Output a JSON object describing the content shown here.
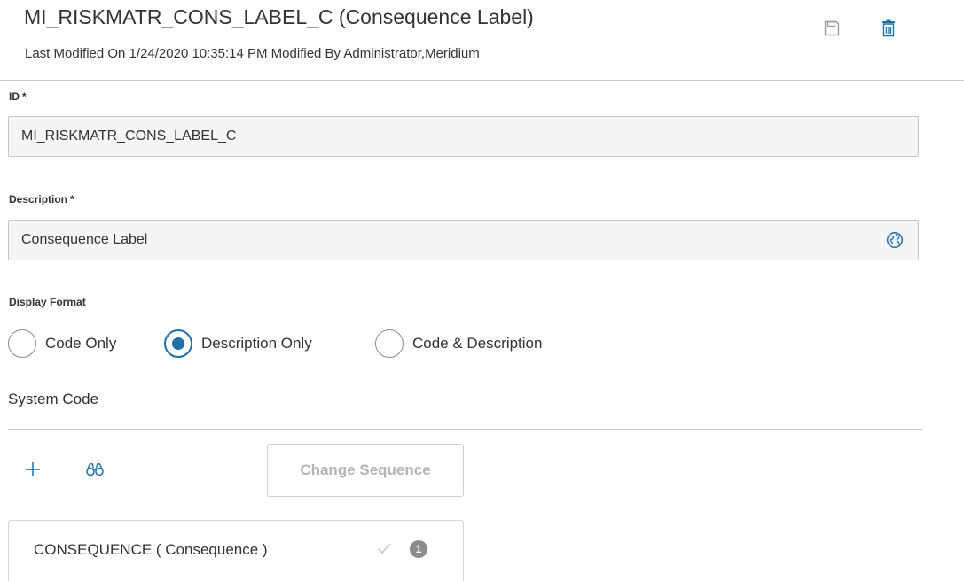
{
  "header": {
    "title": "MI_RISKMATR_CONS_LABEL_C (Consequence Label)",
    "subtitle": "Last Modified On 1/24/2020 10:35:14 PM Modified By Administrator,Meridium",
    "save_icon": "save-icon",
    "delete_icon": "trash-icon"
  },
  "form": {
    "id": {
      "label": "ID",
      "required_mark": "*",
      "value": "MI_RISKMATR_CONS_LABEL_C"
    },
    "description": {
      "label": "Description",
      "required_mark": "*",
      "value": "Consequence Label",
      "icon": "globe-icon"
    },
    "display_format": {
      "label": "Display Format",
      "selected": "Description Only",
      "options": [
        {
          "label": "Code Only",
          "checked": false
        },
        {
          "label": "Description Only",
          "checked": true
        },
        {
          "label": "Code & Description",
          "checked": false
        }
      ]
    }
  },
  "system_code": {
    "label": "System Code",
    "toolbar": {
      "add_icon": "plus-icon",
      "search_icon": "binoculars-icon",
      "change_sequence_label": "Change Sequence"
    },
    "items": [
      {
        "label": "CONSEQUENCE ( Consequence )",
        "check_icon": "check-icon",
        "badge": "1"
      }
    ]
  },
  "colors": {
    "accent": "#1f6fa8",
    "text": "#333333",
    "field_bg": "#f5f5f5",
    "border": "#c6c6c6",
    "disabled_text": "#b4b4b4",
    "badge_bg": "#8c8c8c"
  }
}
